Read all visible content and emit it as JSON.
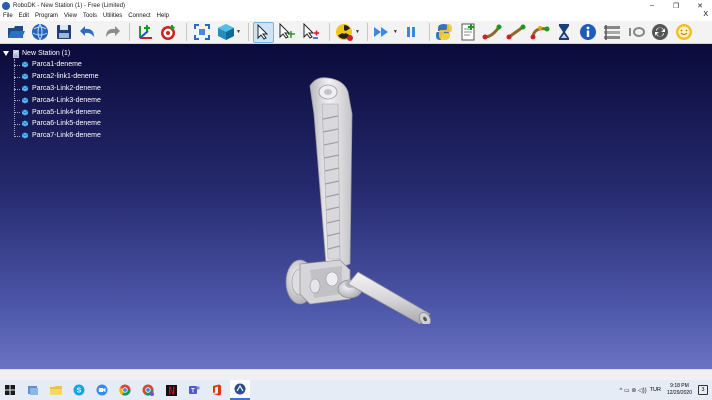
{
  "window": {
    "title": "RoboDK - New Station (1) - Free (Limited)",
    "controls": {
      "minimize": "–",
      "restore": "❐",
      "close": "✕"
    }
  },
  "menu": {
    "items": [
      "File",
      "Edit",
      "Program",
      "View",
      "Tools",
      "Utilities",
      "Connect",
      "Help"
    ],
    "close_glyph": "X"
  },
  "toolbar": {
    "icons": [
      "open-icon",
      "web-library-icon",
      "save-icon",
      "undo-icon",
      "redo-icon",
      "add-reference-frame-icon",
      "add-target-icon",
      "fit-all-icon",
      "isometric-view-icon",
      "select-cursor-icon",
      "move-reference-icon",
      "move-tool-icon",
      "collision-check-icon",
      "fast-forward-icon",
      "pause-icon",
      "python-icon",
      "add-program-icon",
      "move-joint-icon",
      "move-linear-icon",
      "move-circular-icon",
      "wait-icon",
      "info-icon",
      "program-call-icon",
      "io-icon",
      "refresh-icon",
      "settings-robot-icon"
    ]
  },
  "tree": {
    "root": "New Station (1)",
    "items": [
      "Parca1-deneme",
      "Parca2-link1-deneme",
      "Parca3-Link2-deneme",
      "Parca4-Link3-deneme",
      "Parca5-Link4-deneme",
      "Parca6-Link5-deneme",
      "Parca7-Link6-deneme"
    ]
  },
  "taskbar": {
    "apps": [
      "windows-start-icon",
      "file-explorer-icon",
      "folder-icon",
      "skype-icon",
      "zoom-icon",
      "chrome-icon",
      "chrome-profile-icon",
      "netflix-icon",
      "teams-icon",
      "office-icon",
      "robodk-icon"
    ],
    "tray_glyphs": "^  ▭  ⊚  ◁))",
    "language": "TUR",
    "time": "9:18 PM",
    "date": "12/29/2020",
    "notification_count": "3"
  },
  "colors": {
    "viewport_top": "#0a0a3a",
    "viewport_bottom": "#6a73c3",
    "part": "#e8e8ea"
  }
}
